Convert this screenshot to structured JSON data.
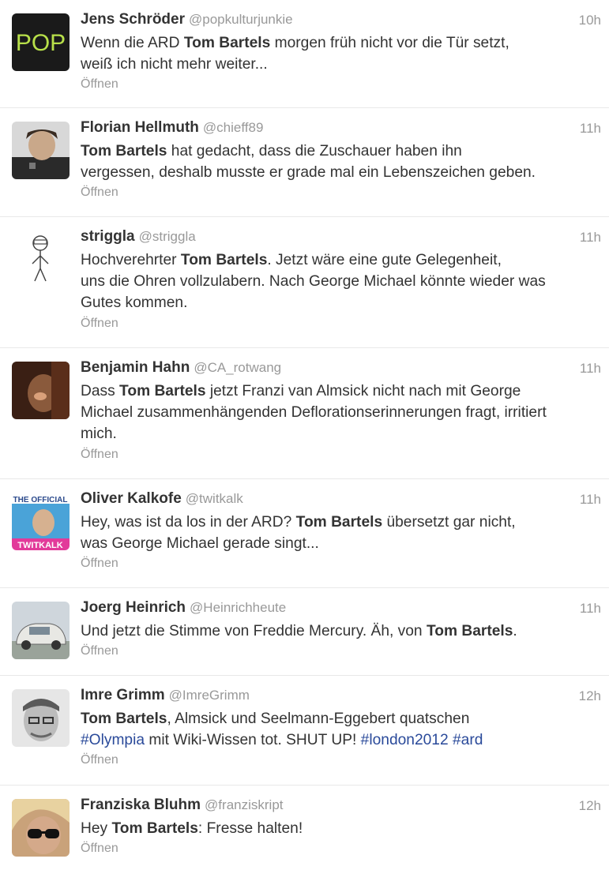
{
  "open_label": "Öffnen",
  "tweets": [
    {
      "name": "Jens Schröder",
      "handle": "@popkulturjunkie",
      "time": "10h",
      "avatar_icon": "pop-logo-avatar",
      "lines": [
        [
          {
            "t": "Wenn die ARD "
          },
          {
            "t": "Tom Bartels",
            "b": true
          },
          {
            "t": " morgen früh nicht vor die Tür setzt,"
          }
        ],
        [
          {
            "t": "weiß ich nicht mehr weiter..."
          }
        ]
      ]
    },
    {
      "name": "Florian Hellmuth",
      "handle": "@chieff89",
      "time": "11h",
      "avatar_icon": "person-photo-avatar",
      "lines": [
        [
          {
            "t": "Tom Bartels",
            "b": true
          },
          {
            "t": " hat gedacht, dass die Zuschauer haben ihn"
          }
        ],
        [
          {
            "t": "vergessen, deshalb musste er grade mal ein Lebenszeichen geben."
          }
        ]
      ]
    },
    {
      "name": "striggla",
      "handle": "@striggla",
      "time": "11h",
      "avatar_icon": "stick-figure-avatar",
      "lines": [
        [
          {
            "t": "Hochverehrter "
          },
          {
            "t": "Tom Bartels",
            "b": true
          },
          {
            "t": ". Jetzt wäre eine gute Gelegenheit,"
          }
        ],
        [
          {
            "t": "uns die Ohren vollzulabern. Nach George Michael könnte wieder was"
          }
        ],
        [
          {
            "t": "Gutes kommen."
          }
        ]
      ]
    },
    {
      "name": "Benjamin Hahn",
      "handle": "@CA_rotwang",
      "time": "11h",
      "avatar_icon": "dark-photo-avatar",
      "lines": [
        [
          {
            "t": "Dass "
          },
          {
            "t": "Tom Bartels",
            "b": true
          },
          {
            "t": " jetzt Franzi van Almsick nicht nach mit George"
          }
        ],
        [
          {
            "t": "Michael zusammenhängenden Deflorationserinnerungen fragt, irritiert"
          }
        ],
        [
          {
            "t": "mich."
          }
        ]
      ]
    },
    {
      "name": "Oliver Kalkofe",
      "handle": "@twitkalk",
      "time": "11h",
      "avatar_icon": "twitkalk-avatar",
      "avatar_text_top": "THE OFFICIAL",
      "avatar_text_bottom": "TWITKALK",
      "lines": [
        [
          {
            "t": "Hey, was ist da los in der ARD? "
          },
          {
            "t": "Tom Bartels",
            "b": true
          },
          {
            "t": " übersetzt gar nicht,"
          }
        ],
        [
          {
            "t": "was George Michael gerade singt..."
          }
        ]
      ]
    },
    {
      "name": "Joerg Heinrich",
      "handle": "@Heinrichheute",
      "time": "11h",
      "avatar_icon": "vintage-car-avatar",
      "lines": [
        [
          {
            "t": "Und jetzt die Stimme von Freddie Mercury. Äh, von "
          },
          {
            "t": "Tom Bartels",
            "b": true
          },
          {
            "t": "."
          }
        ]
      ]
    },
    {
      "name": "Imre Grimm",
      "handle": "@ImreGrimm",
      "time": "12h",
      "avatar_icon": "bw-portrait-avatar",
      "lines": [
        [
          {
            "t": "Tom Bartels",
            "b": true
          },
          {
            "t": ", Almsick und Seelmann-Eggebert quatschen"
          }
        ],
        [
          {
            "t": "#Olympia",
            "h": true
          },
          {
            "t": " mit Wiki-Wissen tot. SHUT UP! "
          },
          {
            "t": "#london2012",
            "h": true
          },
          {
            "t": " "
          },
          {
            "t": "#ard",
            "h": true
          }
        ]
      ]
    },
    {
      "name": "Franziska Bluhm",
      "handle": "@franziskript",
      "time": "12h",
      "avatar_icon": "sunglasses-portrait-avatar",
      "lines": [
        [
          {
            "t": "Hey "
          },
          {
            "t": "Tom Bartels",
            "b": true
          },
          {
            "t": ": Fresse halten!"
          }
        ]
      ]
    }
  ]
}
